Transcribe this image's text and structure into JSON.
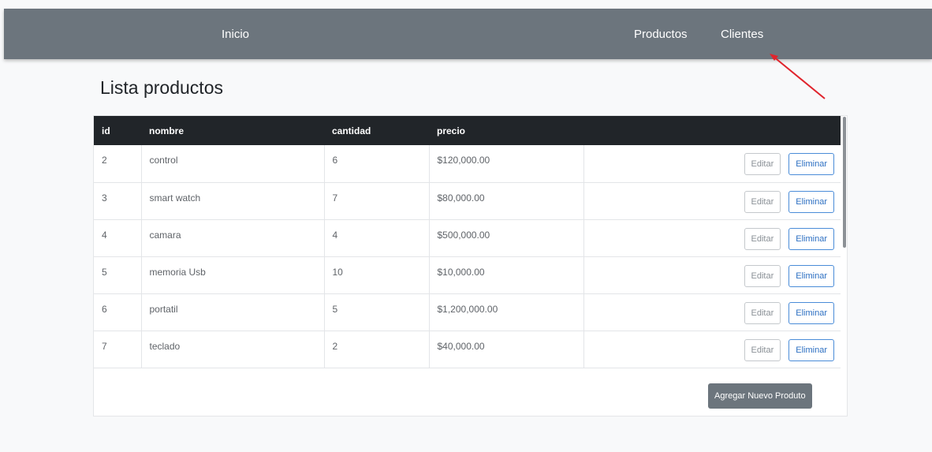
{
  "navbar": {
    "home": "Inicio",
    "links": [
      "Productos",
      "Clientes"
    ]
  },
  "page": {
    "title": "Lista productos"
  },
  "table": {
    "headers": [
      "id",
      "nombre",
      "cantidad",
      "precio",
      ""
    ],
    "rows": [
      {
        "id": "2",
        "nombre": "control",
        "cantidad": "6",
        "precio": "$120,000.00"
      },
      {
        "id": "3",
        "nombre": "smart watch",
        "cantidad": "7",
        "precio": "$80,000.00"
      },
      {
        "id": "4",
        "nombre": "camara",
        "cantidad": "4",
        "precio": "$500,000.00"
      },
      {
        "id": "5",
        "nombre": "memoria Usb",
        "cantidad": "10",
        "precio": "$10,000.00"
      },
      {
        "id": "6",
        "nombre": "portatil",
        "cantidad": "5",
        "precio": "$1,200,000.00"
      },
      {
        "id": "7",
        "nombre": "teclado",
        "cantidad": "2",
        "precio": "$40,000.00"
      }
    ],
    "edit_label": "Editar",
    "delete_label": "Eliminar"
  },
  "actions": {
    "add_label": "Agregar Nuevo Produto"
  },
  "colors": {
    "navbar": "#6c757d",
    "table_header": "#212529",
    "delete_border": "#4a8cd8",
    "arrow": "#e0242c"
  }
}
